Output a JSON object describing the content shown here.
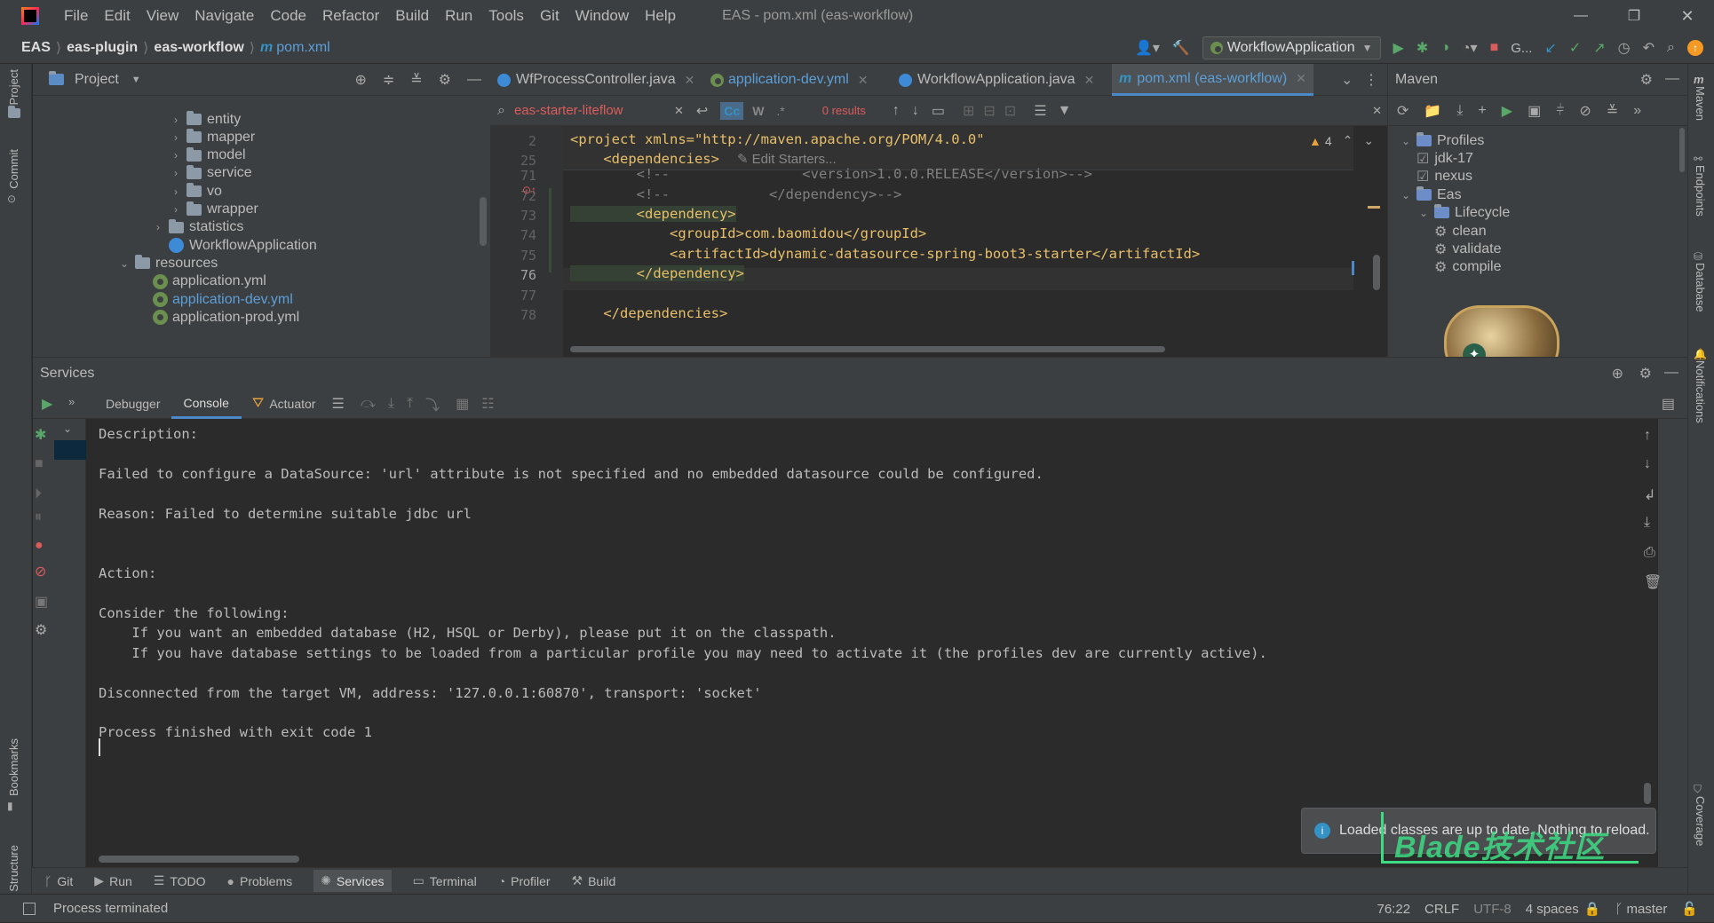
{
  "app": {
    "title": "EAS - pom.xml (eas-workflow)"
  },
  "menu": [
    "File",
    "Edit",
    "View",
    "Navigate",
    "Code",
    "Refactor",
    "Build",
    "Run",
    "Tools",
    "Git",
    "Window",
    "Help"
  ],
  "breadcrumb": {
    "root": "EAS",
    "module": "eas-plugin",
    "submodule": "eas-workflow",
    "file": "pom.xml"
  },
  "toolbar": {
    "run_config": "WorkflowApplication",
    "git_label": "G..."
  },
  "left_strip": [
    "Project",
    "Commit",
    "Bookmarks",
    "Structure"
  ],
  "right_strip": [
    "Maven",
    "Endpoints",
    "Database",
    "Notifications",
    "Coverage"
  ],
  "project": {
    "header": "Project",
    "tree": [
      {
        "label": "entity",
        "type": "folder"
      },
      {
        "label": "mapper",
        "type": "folder"
      },
      {
        "label": "model",
        "type": "folder"
      },
      {
        "label": "service",
        "type": "folder"
      },
      {
        "label": "vo",
        "type": "folder"
      },
      {
        "label": "wrapper",
        "type": "folder"
      },
      {
        "label": "statistics",
        "type": "folder"
      },
      {
        "label": "WorkflowApplication",
        "type": "class"
      },
      {
        "label": "resources",
        "type": "folder"
      },
      {
        "label": "application.yml",
        "type": "yml"
      },
      {
        "label": "application-dev.yml",
        "type": "yml"
      },
      {
        "label": "application-prod.yml",
        "type": "yml"
      }
    ]
  },
  "editor": {
    "tabs": [
      {
        "label": "WfProcessController.java"
      },
      {
        "label": "application-dev.yml"
      },
      {
        "label": "WorkflowApplication.java"
      },
      {
        "label": "pom.xml (eas-workflow)"
      }
    ],
    "find": {
      "query": "eas-starter-liteflow",
      "results": "0 results",
      "case_label": "Cc",
      "word_label": "W",
      "regex_label": ".*"
    },
    "warnings": "4",
    "edit_starters": "Edit Starters...",
    "lines": [
      {
        "num": "2",
        "text": "<project xmlns=\"http://maven.apache.org/POM/4.0.0\""
      },
      {
        "num": "25",
        "text": "    <dependencies>"
      },
      {
        "num": "71",
        "text": "        <!--                <version>1.0.0.RELEASE</version>-->"
      },
      {
        "num": "72",
        "text": "        <!--            </dependency>-->"
      },
      {
        "num": "73",
        "text": "        <dependency>"
      },
      {
        "num": "74",
        "text": "            <groupId>com.baomidou</groupId>"
      },
      {
        "num": "75",
        "text": "            <artifactId>dynamic-datasource-spring-boot3-starter</artifactId>"
      },
      {
        "num": "76",
        "text": "        </dependency>"
      },
      {
        "num": "77",
        "text": ""
      },
      {
        "num": "78",
        "text": "    </dependencies>"
      }
    ]
  },
  "maven": {
    "header": "Maven",
    "items": [
      {
        "label": "Profiles",
        "level": 0
      },
      {
        "label": "jdk-17",
        "level": 1,
        "checked": true
      },
      {
        "label": "nexus",
        "level": 1,
        "checked": true
      },
      {
        "label": "Eas",
        "level": 0
      },
      {
        "label": "Lifecycle",
        "level": 1
      },
      {
        "label": "clean",
        "level": 2
      },
      {
        "label": "validate",
        "level": 2
      },
      {
        "label": "compile",
        "level": 2
      }
    ]
  },
  "services": {
    "header": "Services",
    "tabs": [
      "Debugger",
      "Console",
      "Actuator"
    ],
    "console": [
      "Description:",
      "",
      "Failed to configure a DataSource: 'url' attribute is not specified and no embedded datasource could be configured.",
      "",
      "Reason: Failed to determine suitable jdbc url",
      "",
      "",
      "Action:",
      "",
      "Consider the following:",
      "    If you want an embedded database (H2, HSQL or Derby), please put it on the classpath.",
      "    If you have database settings to be loaded from a particular profile you may need to activate it (the profiles dev are currently active).",
      "",
      "Disconnected from the target VM, address: '127.0.0.1:60870', transport: 'socket'",
      "",
      "Process finished with exit code 1"
    ]
  },
  "notification": {
    "text": "Loaded classes are up to date. Nothing to reload.",
    "watermark": "Blade技术社区"
  },
  "bottom_tabs": [
    "Git",
    "Run",
    "TODO",
    "Problems",
    "Services",
    "Terminal",
    "Profiler",
    "Build"
  ],
  "status": {
    "message": "Process terminated",
    "position": "76:22",
    "line_sep": "CRLF",
    "encoding": "UTF-8",
    "indent": "4 spaces",
    "branch": "master"
  },
  "colors": {
    "accent": "#3592c4",
    "run_green": "#59a869",
    "stop_red": "#db5c5c",
    "xml_tag": "#e8bf6a",
    "xml_value": "#6a8759",
    "comment": "#808080"
  }
}
